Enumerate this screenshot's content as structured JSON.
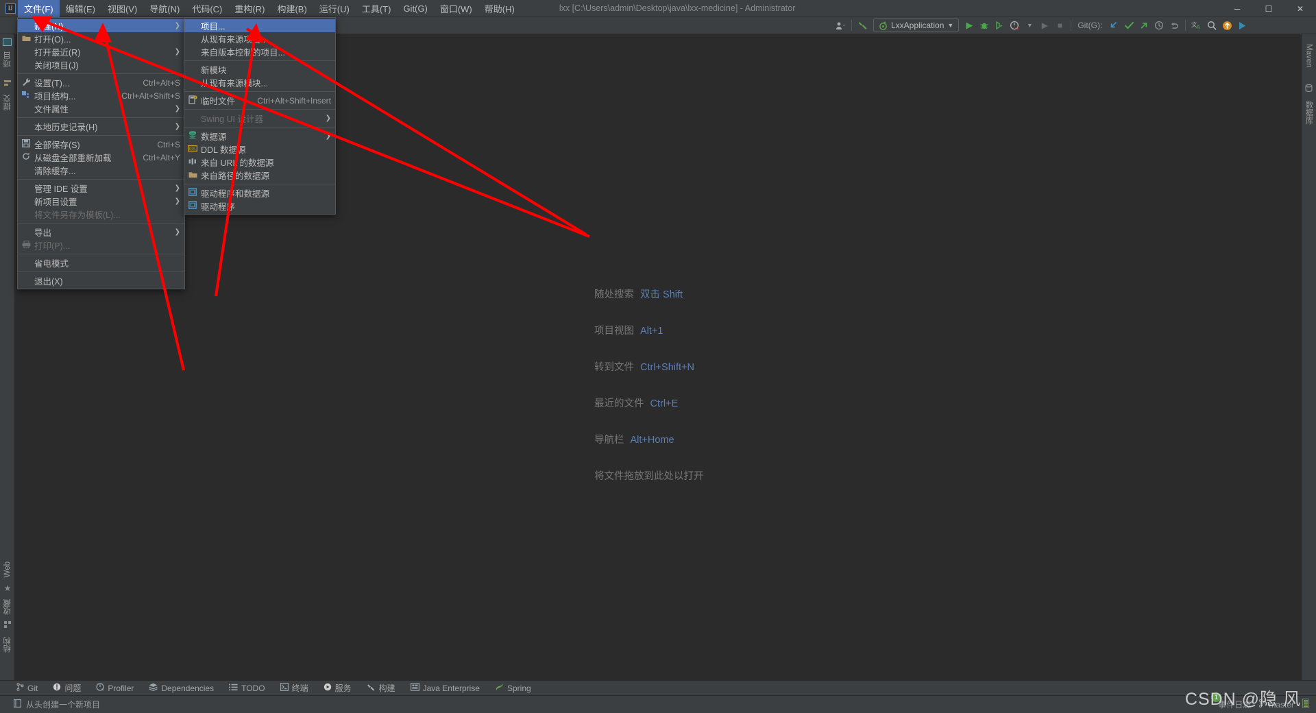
{
  "window": {
    "title": "lxx [C:\\Users\\admin\\Desktop\\java\\lxx-medicine] - Administrator",
    "logo": "IJ",
    "minimize": "─",
    "maximize": "☐",
    "close": "✕"
  },
  "menubar": [
    {
      "label": "文件(F)",
      "mnemonic": "F",
      "active": true
    },
    {
      "label": "编辑(E)",
      "mnemonic": "E",
      "active": false
    },
    {
      "label": "视图(V)",
      "mnemonic": "V",
      "active": false
    },
    {
      "label": "导航(N)",
      "mnemonic": "N",
      "active": false
    },
    {
      "label": "代码(C)",
      "mnemonic": "C",
      "active": false
    },
    {
      "label": "重构(R)",
      "mnemonic": "R",
      "active": false
    },
    {
      "label": "构建(B)",
      "mnemonic": "B",
      "active": false
    },
    {
      "label": "运行(U)",
      "mnemonic": "U",
      "active": false
    },
    {
      "label": "工具(T)",
      "mnemonic": "T",
      "active": false
    },
    {
      "label": "Git(G)",
      "mnemonic": "G",
      "active": false
    },
    {
      "label": "窗口(W)",
      "mnemonic": "W",
      "active": false
    },
    {
      "label": "帮助(H)",
      "mnemonic": "H",
      "active": false
    }
  ],
  "toolbar": {
    "run_config": "LxxApplication",
    "git_label": "Git(G):",
    "icons": [
      "user-avatar-icon",
      "build-hammer-icon",
      "run-icon",
      "debug-icon",
      "run-coverage-icon",
      "profile-icon",
      "attach-icon",
      "stop-icon",
      "update-project-icon",
      "commit-icon",
      "push-icon",
      "history-icon",
      "rollback-icon",
      "translate-icon",
      "search-everywhere-icon",
      "update-available-icon",
      "ide-feature-icon"
    ]
  },
  "file_menu": {
    "items": [
      {
        "label": "新建(N)",
        "icon": "",
        "shortcut": "",
        "submenu": true,
        "selected": true,
        "disabled": false
      },
      {
        "label": "打开(O)...",
        "icon": "folder-icon",
        "shortcut": "",
        "submenu": false,
        "selected": false,
        "disabled": false
      },
      {
        "label": "打开最近(R)",
        "icon": "",
        "shortcut": "",
        "submenu": true,
        "selected": false,
        "disabled": false
      },
      {
        "label": "关闭项目(J)",
        "icon": "",
        "shortcut": "",
        "submenu": false,
        "selected": false,
        "disabled": false
      },
      {
        "separator": true
      },
      {
        "label": "设置(T)...",
        "icon": "wrench-icon",
        "shortcut": "Ctrl+Alt+S",
        "submenu": false,
        "selected": false,
        "disabled": false
      },
      {
        "label": "项目结构...",
        "icon": "project-structure-icon",
        "shortcut": "Ctrl+Alt+Shift+S",
        "submenu": false,
        "selected": false,
        "disabled": false
      },
      {
        "label": "文件属性",
        "icon": "",
        "shortcut": "",
        "submenu": true,
        "selected": false,
        "disabled": false
      },
      {
        "separator": true
      },
      {
        "label": "本地历史记录(H)",
        "icon": "",
        "shortcut": "",
        "submenu": true,
        "selected": false,
        "disabled": false
      },
      {
        "separator": true
      },
      {
        "label": "全部保存(S)",
        "icon": "save-icon",
        "shortcut": "Ctrl+S",
        "submenu": false,
        "selected": false,
        "disabled": false
      },
      {
        "label": "从磁盘全部重新加载",
        "icon": "reload-icon",
        "shortcut": "Ctrl+Alt+Y",
        "submenu": false,
        "selected": false,
        "disabled": false
      },
      {
        "label": "清除缓存...",
        "icon": "",
        "shortcut": "",
        "submenu": false,
        "selected": false,
        "disabled": false
      },
      {
        "separator": true
      },
      {
        "label": "管理 IDE 设置",
        "icon": "",
        "shortcut": "",
        "submenu": true,
        "selected": false,
        "disabled": false
      },
      {
        "label": "新项目设置",
        "icon": "",
        "shortcut": "",
        "submenu": true,
        "selected": false,
        "disabled": false
      },
      {
        "label": "将文件另存为模板(L)...",
        "icon": "",
        "shortcut": "",
        "submenu": false,
        "selected": false,
        "disabled": true
      },
      {
        "separator": true
      },
      {
        "label": "导出",
        "icon": "",
        "shortcut": "",
        "submenu": true,
        "selected": false,
        "disabled": false
      },
      {
        "label": "打印(P)...",
        "icon": "print-icon",
        "shortcut": "",
        "submenu": false,
        "selected": false,
        "disabled": true
      },
      {
        "separator": true
      },
      {
        "label": "省电模式",
        "icon": "",
        "shortcut": "",
        "submenu": false,
        "selected": false,
        "disabled": false
      },
      {
        "separator": true
      },
      {
        "label": "退出(X)",
        "icon": "",
        "shortcut": "",
        "submenu": false,
        "selected": false,
        "disabled": false
      }
    ]
  },
  "new_submenu": {
    "items": [
      {
        "label": "项目...",
        "icon": "",
        "shortcut": "",
        "submenu": false,
        "selected": true,
        "disabled": false
      },
      {
        "label": "从现有来源项目...",
        "icon": "",
        "shortcut": "",
        "submenu": false,
        "selected": false,
        "disabled": false
      },
      {
        "label": "来自版本控制的项目...",
        "icon": "",
        "shortcut": "",
        "submenu": false,
        "selected": false,
        "disabled": false
      },
      {
        "separator": true
      },
      {
        "label": "新模块",
        "icon": "",
        "shortcut": "",
        "submenu": false,
        "selected": false,
        "disabled": false
      },
      {
        "label": "从现有来源模块...",
        "icon": "",
        "shortcut": "",
        "submenu": false,
        "selected": false,
        "disabled": false
      },
      {
        "separator": true
      },
      {
        "label": "临时文件",
        "icon": "scratch-file-icon",
        "shortcut": "Ctrl+Alt+Shift+Insert",
        "submenu": false,
        "selected": false,
        "disabled": false
      },
      {
        "separator": true
      },
      {
        "label": "Swing UI 设计器",
        "icon": "",
        "shortcut": "",
        "submenu": true,
        "selected": false,
        "disabled": true
      },
      {
        "separator": true
      },
      {
        "label": "数据源",
        "icon": "database-icon",
        "shortcut": "",
        "submenu": true,
        "selected": false,
        "disabled": false
      },
      {
        "label": "DDL 数据源",
        "icon": "ddl-icon",
        "shortcut": "",
        "submenu": false,
        "selected": false,
        "disabled": false
      },
      {
        "label": "来自 URL 的数据源",
        "icon": "url-datasource-icon",
        "shortcut": "",
        "submenu": false,
        "selected": false,
        "disabled": false
      },
      {
        "label": "来自路径的数据源",
        "icon": "folder-icon",
        "shortcut": "",
        "submenu": false,
        "selected": false,
        "disabled": false
      },
      {
        "separator": true
      },
      {
        "label": "驱动程序和数据源",
        "icon": "driver-icon",
        "shortcut": "",
        "submenu": false,
        "selected": false,
        "disabled": false
      },
      {
        "label": "驱动程序",
        "icon": "driver-icon",
        "shortcut": "",
        "submenu": false,
        "selected": false,
        "disabled": false
      }
    ]
  },
  "editor_hints": [
    {
      "label": "随处搜索",
      "key": "双击 Shift"
    },
    {
      "label": "项目视图",
      "key": "Alt+1"
    },
    {
      "label": "转到文件",
      "key": "Ctrl+Shift+N"
    },
    {
      "label": "最近的文件",
      "key": "Ctrl+E"
    },
    {
      "label": "导航栏",
      "key": "Alt+Home"
    }
  ],
  "editor_drop_hint": "将文件拖放到此处以打开",
  "left_stripe": [
    {
      "label": "项目",
      "icon": "project-icon"
    },
    {
      "label": "提交",
      "icon": "commit-icon"
    },
    {
      "label": "结构",
      "icon": "structure-icon"
    },
    {
      "label": "收藏",
      "icon": "favorites-icon"
    },
    {
      "label": "Web",
      "icon": "web-icon"
    }
  ],
  "right_stripe": [
    {
      "label": "Maven",
      "icon": "maven-icon"
    },
    {
      "label": "数据库",
      "icon": "database-icon"
    }
  ],
  "toolwindow_bar": [
    {
      "label": "Git",
      "icon": "git-branch-icon"
    },
    {
      "label": "问题",
      "icon": "problems-icon"
    },
    {
      "label": "Profiler",
      "icon": "profiler-icon"
    },
    {
      "label": "Dependencies",
      "icon": "dependencies-icon"
    },
    {
      "label": "TODO",
      "icon": "todo-icon"
    },
    {
      "label": "终端",
      "icon": "terminal-icon"
    },
    {
      "label": "服务",
      "icon": "services-icon"
    },
    {
      "label": "构建",
      "icon": "build-icon"
    },
    {
      "label": "Java Enterprise",
      "icon": "java-enterprise-icon"
    },
    {
      "label": "Spring",
      "icon": "spring-icon"
    }
  ],
  "statusbar": {
    "message": "从头创建一个新项目",
    "message_icon": "new-project-icon",
    "event_log": "事件日志",
    "branch": "master",
    "notification_count": "1"
  },
  "watermark": "CSDN @隐 风",
  "colors": {
    "accent": "#4b6eaf",
    "annotation": "#ff0000",
    "panel": "#3c3f41",
    "editor_bg": "#2b2b2b",
    "hint_key": "#5c7fb5",
    "text": "#bbbbbb"
  }
}
